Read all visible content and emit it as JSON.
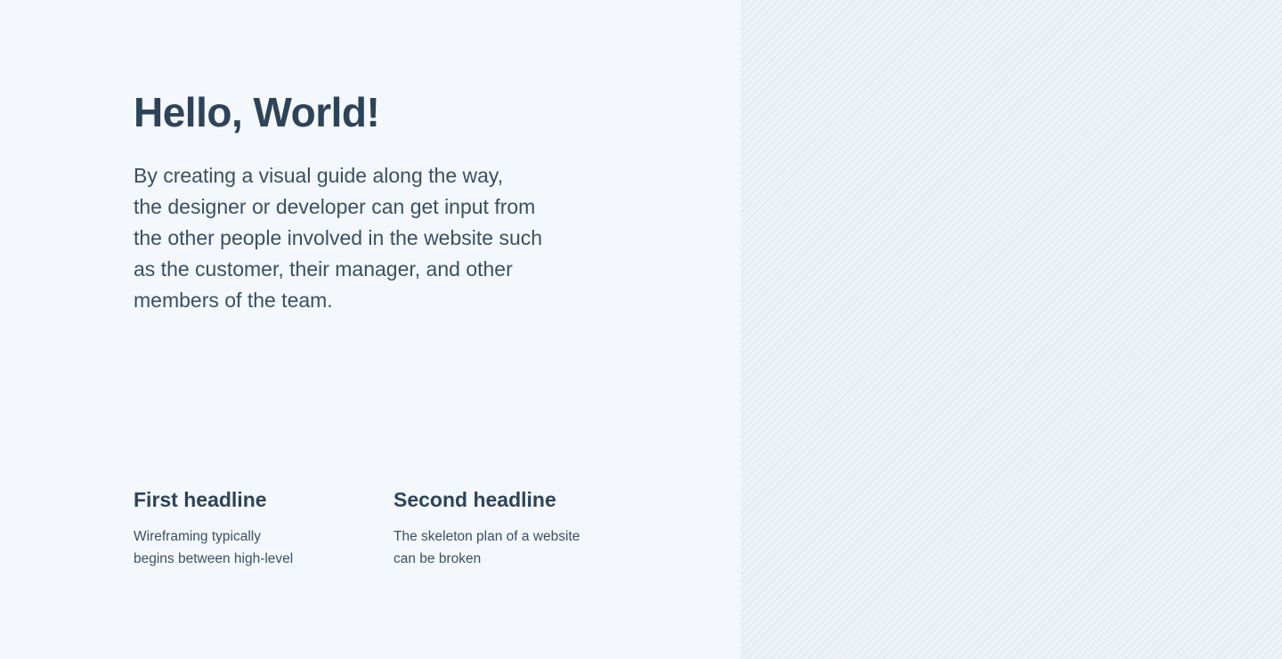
{
  "hero": {
    "title": "Hello, World!",
    "body": "By creating a visual guide along the way,\nthe designer or developer can get input from\nthe other people involved in the website such\nas the customer, their manager, and other\nmembers of the team."
  },
  "features": [
    {
      "headline": "First headline",
      "text": "Wireframing typically\nbegins between high-level"
    },
    {
      "headline": "Second headline",
      "text": "The skeleton plan of a website\ncan be broken"
    }
  ],
  "colors": {
    "background": "#f4f8fc",
    "text_primary": "#2d4359",
    "text_secondary": "#3b4f63",
    "pattern_base": "#eef2f6",
    "pattern_stripe": "#dfe6ee"
  }
}
